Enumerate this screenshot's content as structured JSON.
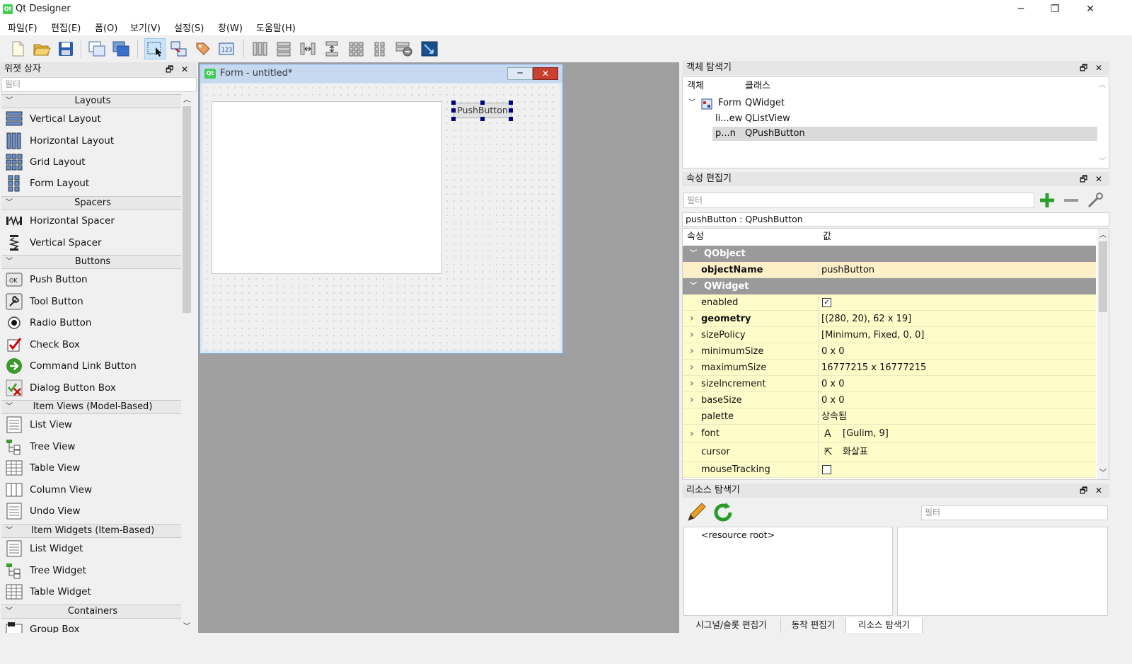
{
  "window": {
    "title": "Qt Designer",
    "app_icon_text": "Qt",
    "minimize": "─",
    "restore": "❐",
    "close": "✕"
  },
  "menubar": [
    "파일(F)",
    "편집(E)",
    "폼(O)",
    "보기(V)",
    "설정(S)",
    "창(W)",
    "도움말(H)"
  ],
  "toolbar": [
    "new-file-icon",
    "open-folder-icon",
    "save-icon",
    "copy-form-icon",
    "paste-form-icon",
    "edit-widgets-icon",
    "edit-signals-icon",
    "edit-buddies-icon",
    "edit-tab-order-icon",
    "layout-horizontal-icon",
    "layout-vertical-icon",
    "layout-horizontal-splitter-icon",
    "layout-vertical-splitter-icon",
    "layout-grid-icon",
    "layout-form-icon",
    "break-layout-icon",
    "adjust-size-icon"
  ],
  "widget_box": {
    "title": "위젯 상자",
    "filter_placeholder": "필터",
    "categories": [
      {
        "name": "Layouts",
        "items": [
          "Vertical Layout",
          "Horizontal Layout",
          "Grid Layout",
          "Form Layout"
        ]
      },
      {
        "name": "Spacers",
        "items": [
          "Horizontal Spacer",
          "Vertical Spacer"
        ]
      },
      {
        "name": "Buttons",
        "items": [
          "Push Button",
          "Tool Button",
          "Radio Button",
          "Check Box",
          "Command Link Button",
          "Dialog Button Box"
        ]
      },
      {
        "name": "Item Views (Model-Based)",
        "items": [
          "List View",
          "Tree View",
          "Table View",
          "Column View",
          "Undo View"
        ]
      },
      {
        "name": "Item Widgets (Item-Based)",
        "items": [
          "List Widget",
          "Tree Widget",
          "Table Widget"
        ]
      },
      {
        "name": "Containers",
        "items": [
          "Group Box"
        ]
      }
    ]
  },
  "form": {
    "title": "Form - untitled*",
    "icon_text": "Qt",
    "button_label": "PushButton"
  },
  "object_inspector": {
    "title": "객체 탐색기",
    "col_object": "객체",
    "col_class": "클래스",
    "rows": [
      {
        "object": "Form",
        "class": "QWidget"
      },
      {
        "object": "li...ew",
        "class": "QListView"
      },
      {
        "object": "p...n",
        "class": "QPushButton"
      }
    ]
  },
  "property_editor": {
    "title": "속성 편집기",
    "filter_placeholder": "필터",
    "object_label": "pushButton : QPushButton",
    "col_property": "속성",
    "col_value": "값",
    "rows": [
      {
        "type": "group",
        "name": "QObject"
      },
      {
        "type": "prop",
        "name": "objectName",
        "value": "pushButton",
        "bold": true,
        "shade": "o"
      },
      {
        "type": "group",
        "name": "QWidget"
      },
      {
        "type": "check",
        "name": "enabled",
        "checked": true,
        "shade": "y"
      },
      {
        "type": "prop",
        "name": "geometry",
        "value": "[(280, 20), 62 x 19]",
        "bold": true,
        "expand": true,
        "shade": "y"
      },
      {
        "type": "prop",
        "name": "sizePolicy",
        "value": "[Minimum, Fixed, 0, 0]",
        "expand": true,
        "shade": "y"
      },
      {
        "type": "prop",
        "name": "minimumSize",
        "value": "0 x 0",
        "expand": true,
        "shade": "y"
      },
      {
        "type": "prop",
        "name": "maximumSize",
        "value": "16777215 x 16777215",
        "expand": true,
        "shade": "y"
      },
      {
        "type": "prop",
        "name": "sizeIncrement",
        "value": "0 x 0",
        "expand": true,
        "shade": "y"
      },
      {
        "type": "prop",
        "name": "baseSize",
        "value": "0 x 0",
        "expand": true,
        "shade": "y"
      },
      {
        "type": "prop",
        "name": "palette",
        "value": "상속됨",
        "shade": "y"
      },
      {
        "type": "prop",
        "name": "font",
        "value": "[Gulim, 9]",
        "expand": true,
        "icon": "font-icon",
        "shade": "y"
      },
      {
        "type": "prop",
        "name": "cursor",
        "value": "화살표",
        "icon": "cursor-arrow-icon",
        "shade": "y"
      },
      {
        "type": "check",
        "name": "mouseTracking",
        "checked": false,
        "shade": "y"
      }
    ]
  },
  "resource_browser": {
    "title": "리소스 탐색기",
    "filter_placeholder": "필터",
    "root": "<resource root>"
  },
  "bottom_tabs": [
    "시그널/슬롯 편집기",
    "동작 편집기",
    "리소스 탐색기"
  ],
  "colors": {
    "accent": "#41cd52",
    "selection_handle": "#000080",
    "group_row": "#9a9a9a",
    "prop_row": "#fefdc9"
  }
}
